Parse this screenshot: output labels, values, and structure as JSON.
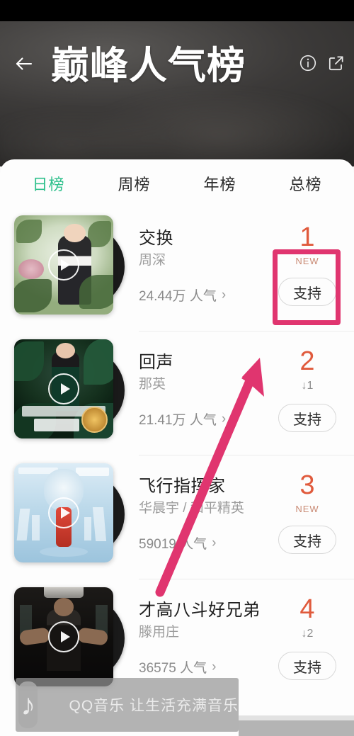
{
  "header": {
    "title": "巅峰人气榜",
    "back_icon": "back-arrow-icon",
    "info_icon": "info-circle-icon",
    "share_icon": "share-external-link-icon"
  },
  "tabs": [
    {
      "label": "日榜",
      "active": true
    },
    {
      "label": "周榜",
      "active": false
    },
    {
      "label": "年榜",
      "active": false
    },
    {
      "label": "总榜",
      "active": false
    }
  ],
  "list": [
    {
      "title": "交换",
      "artist": "周深",
      "heat": "24.44万 人气",
      "chevron": "›",
      "rank": "1",
      "tag": "NEW",
      "change": "",
      "support_label": "支持",
      "play_icon": "play-circle-icon"
    },
    {
      "title": "回声",
      "artist": "那英",
      "heat": "21.41万 人气",
      "chevron": "›",
      "rank": "2",
      "tag": "",
      "change": "↓1",
      "support_label": "支持",
      "play_icon": "play-circle-icon"
    },
    {
      "title": "飞行指挥家",
      "artist": "华晨宇 / 和平精英",
      "heat": "59019 人气",
      "chevron": "›",
      "rank": "3",
      "tag": "NEW",
      "change": "",
      "support_label": "支持",
      "play_icon": "play-circle-icon"
    },
    {
      "title": "才高八斗好兄弟",
      "artist": "滕用庄",
      "heat": "36575 人气",
      "chevron": "›",
      "rank": "4",
      "tag": "",
      "change": "↓2",
      "support_label": "支持",
      "play_icon": "play-circle-icon"
    }
  ],
  "watermark": {
    "text": "QQ音乐 让生活充满音乐",
    "note_glyph": "♪",
    "icon": "music-note-icon"
  },
  "annotations": {
    "highlight_color": "#e0356f",
    "rect_label": "highlight-rectangle-rank-1-support",
    "arrow_label": "pink-arrow-pointing-up-right"
  },
  "colors": {
    "accent_tab": "#2ec08c",
    "rank": "#e05a3c",
    "annotation": "#e0356f"
  }
}
